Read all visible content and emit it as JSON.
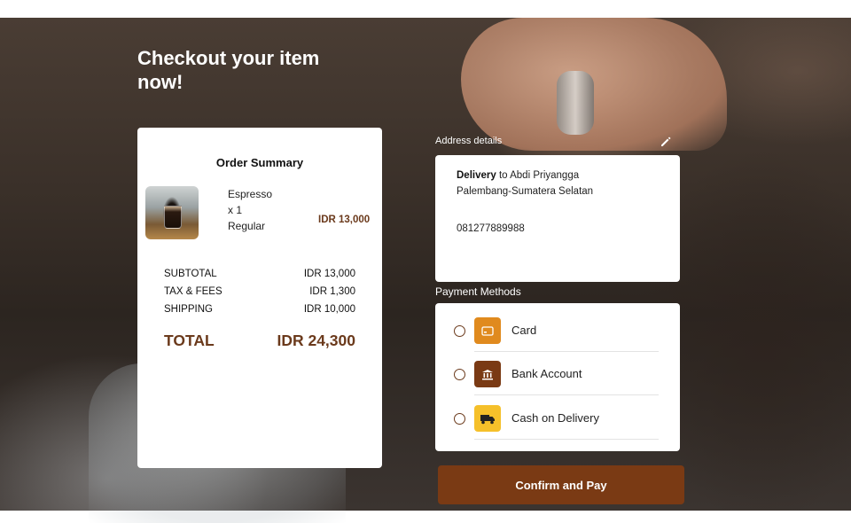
{
  "page": {
    "headline": "Checkout your item now!"
  },
  "order_summary": {
    "title": "Order Summary",
    "item": {
      "name": "Espresso",
      "quantity": "x 1",
      "variant": "Regular",
      "price": "IDR 13,000"
    },
    "fees": [
      {
        "label": "SUBTOTAL",
        "value": "IDR 13,000"
      },
      {
        "label": "TAX & FEES",
        "value": "IDR 1,300"
      },
      {
        "label": "SHIPPING",
        "value": "IDR 10,000"
      }
    ],
    "total_label": "TOTAL",
    "total_value": "IDR 24,300"
  },
  "address": {
    "label": "Address details",
    "delivery_word": "Delivery",
    "recipient": "to Abdi Priyangga",
    "region": "Palembang-Sumatera Selatan",
    "phone": "081277889988",
    "edit_icon": "pencil-icon"
  },
  "payment": {
    "label": "Payment Methods",
    "options": [
      {
        "label": "Card",
        "icon": "card-icon",
        "color": "#e08a1e"
      },
      {
        "label": "Bank Account",
        "icon": "bank-icon",
        "color": "#7a3a14"
      },
      {
        "label": "Cash on Delivery",
        "icon": "truck-icon",
        "color": "#f5c02a"
      }
    ]
  },
  "actions": {
    "confirm_label": "Confirm and Pay"
  },
  "colors": {
    "accent": "#7a3a14",
    "price": "#6b3a1c"
  }
}
